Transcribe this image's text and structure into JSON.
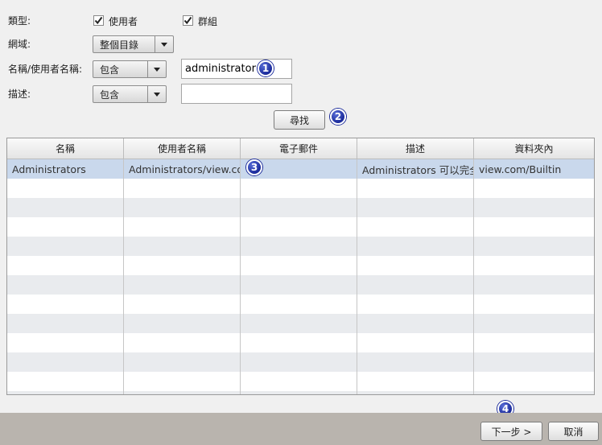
{
  "form": {
    "type_label": "類型:",
    "type_user": "使用者",
    "type_group": "群組",
    "domain_label": "網域:",
    "domain_value": "整個目錄",
    "name_label": "名稱/使用者名稱:",
    "name_match": "包含",
    "name_value": "administrator",
    "desc_label": "描述:",
    "desc_match": "包含",
    "desc_value": "",
    "search_button": "尋找"
  },
  "table": {
    "columns": [
      "名稱",
      "使用者名稱",
      "電子郵件",
      "描述",
      "資料夾內"
    ],
    "rows": [
      [
        "Administrators",
        "Administrators/view.com",
        "",
        "Administrators 可以完全",
        "view.com/Builtin"
      ]
    ]
  },
  "badges": [
    "1",
    "2",
    "3",
    "4"
  ],
  "footer": {
    "next_button": "下一步 >",
    "cancel_button": "取消"
  },
  "colors": {
    "selected_row": "#c9d8ec",
    "badge": "#1a2a9a",
    "footer": "#b9b4ae"
  }
}
